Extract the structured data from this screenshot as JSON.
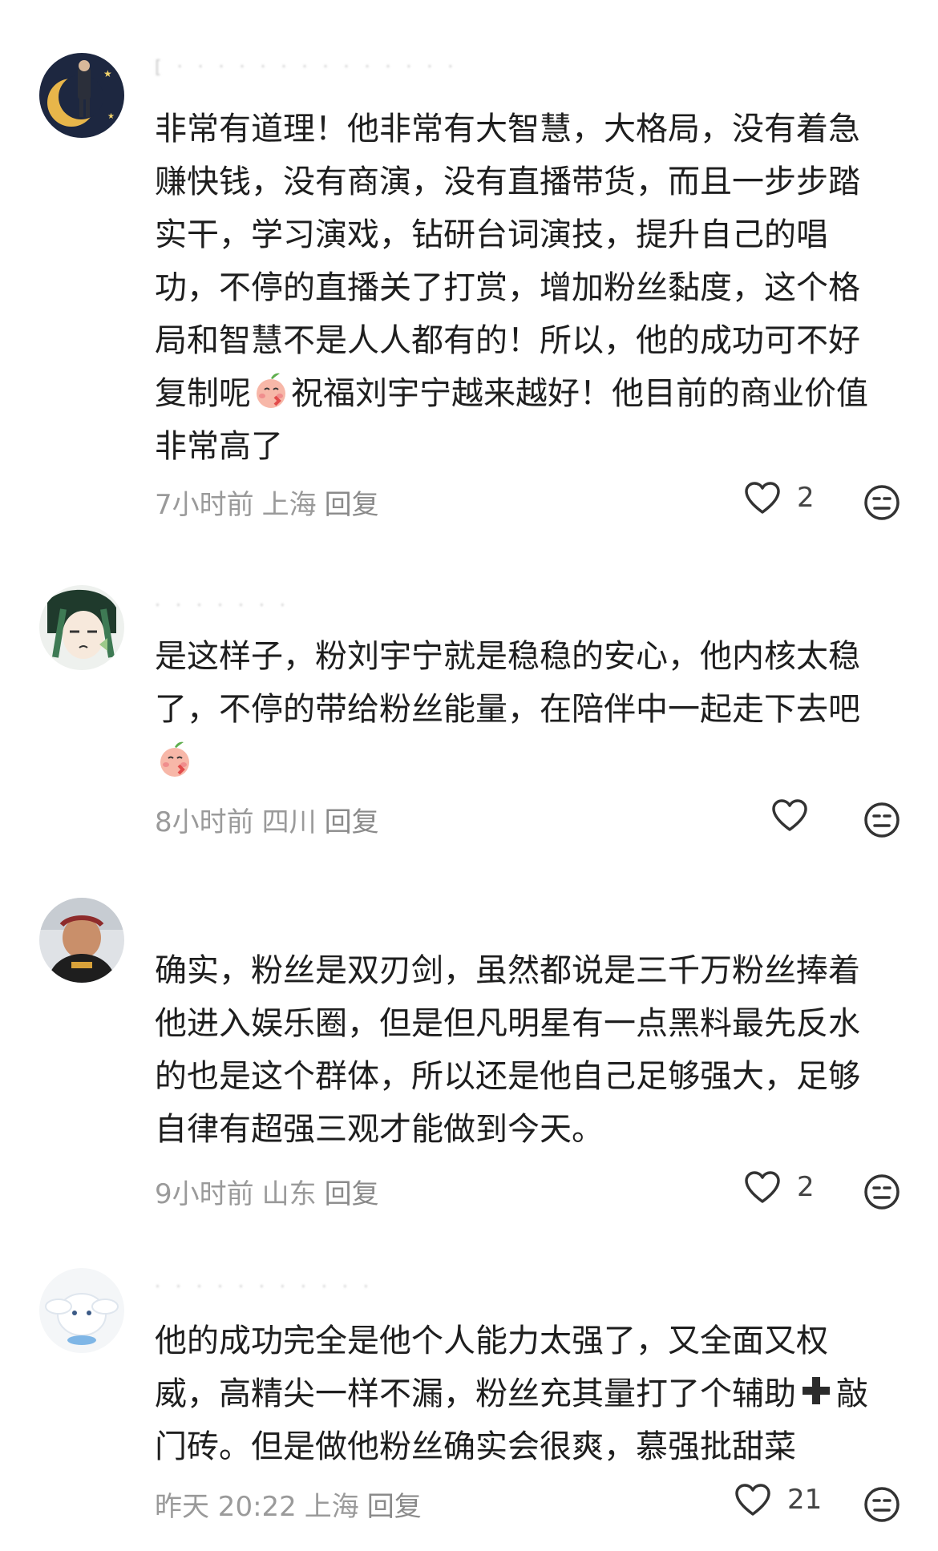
{
  "comments": [
    {
      "username": "[ ‧ ‧ ‧ ‧ ‧ ‧ ‧ ‧ ‧ ‧ ‧ ‧ ‧ ‧",
      "text_before": "非常有道理！他非常有大智慧，大格局，没有着急赚快钱，没有商演，没有直播带货，而且一步步踏实干，学习演戏，钻研台词演技，提升自己的唱功，不停的直播关了打赏，增加粉丝黏度，这个格局和智慧不是人人都有的！所以，他的成功可不好复制呢",
      "text_after": "祝福刘宇宁越来越好！他目前的商业价值非常高了",
      "time": "7小时前",
      "location": "上海",
      "reply": "回复",
      "likes": "2"
    },
    {
      "username": "‧ ‧ ‧ ‧ ‧ ‧ ‧",
      "text_before": "是这样子，粉刘宇宁就是稳稳的安心，他内核太稳了，不停的带给粉丝能量，在陪伴中一起走下去吧",
      "time": "8小时前",
      "location": "四川",
      "reply": "回复",
      "likes": ""
    },
    {
      "username": "",
      "text_before": "确实，粉丝是双刃剑，虽然都说是三千万粉丝捧着他进入娱乐圈，但是但凡明星有一点黑料最先反水的也是这个群体，所以还是他自己足够强大，足够自律有超强三观才能做到今天。",
      "time": "9小时前",
      "location": "山东",
      "reply": "回复",
      "likes": "2"
    },
    {
      "username": "‧ ‧ ‧ ‧ ‧ ‧ ‧ ‧ ‧ ‧ ‧",
      "text_before": "他的成功完全是他个人能力太强了，又全面又权威，高精尖一样不漏，粉丝充其量打了个辅助",
      "text_after": "敲门砖。但是做他粉丝确实会很爽，慕强批甜菜",
      "time": "昨天 20:22",
      "location": "上海",
      "reply": "回复",
      "likes": "21"
    }
  ],
  "icons": {
    "like": "heart-outline-icon",
    "dislike": "neutral-face-icon",
    "emoji": "blushing-peach-emoji",
    "plus": "heavy-plus-emoji"
  },
  "colors": {
    "text": "#1e1e1e",
    "meta": "#9a9a9a",
    "icon": "#333333"
  }
}
